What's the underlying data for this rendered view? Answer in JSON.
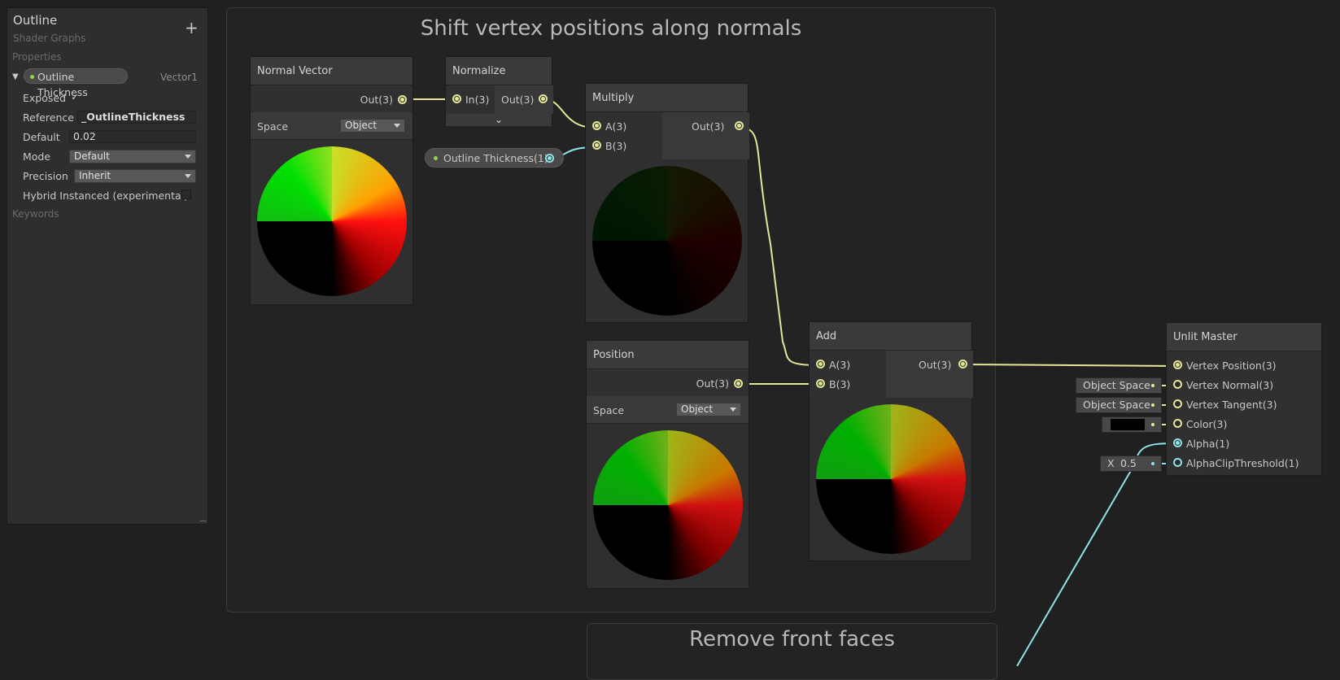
{
  "blackboard": {
    "title": "Outline",
    "subtitle": "Shader Graphs",
    "add_label": "+",
    "properties_label": "Properties",
    "property": {
      "name": "Outline Thickness",
      "type": "Vector1",
      "exposed_label": "Exposed",
      "exposed_check": "✓",
      "reference_label": "Reference",
      "reference_value": "_OutlineThickness",
      "default_label": "Default",
      "default_value": "0.02",
      "mode_label": "Mode",
      "mode_value": "Default",
      "precision_label": "Precision",
      "precision_value": "Inherit",
      "hybrid_label": "Hybrid Instanced (experimental)"
    },
    "keywords_label": "Keywords"
  },
  "groups": {
    "main_title": "Shift vertex positions along normals",
    "second_title": "Remove front faces"
  },
  "nodes": {
    "normal_vector": {
      "title": "Normal Vector",
      "out": "Out(3)",
      "space_label": "Space",
      "space_value": "Object"
    },
    "normalize": {
      "title": "Normalize",
      "in": "In(3)",
      "out": "Out(3)",
      "expand": "⌄"
    },
    "property_node": {
      "label": "Outline Thickness(1)"
    },
    "multiply": {
      "title": "Multiply",
      "a": "A(3)",
      "b": "B(3)",
      "out": "Out(3)"
    },
    "position": {
      "title": "Position",
      "out": "Out(3)",
      "space_label": "Space",
      "space_value": "Object"
    },
    "add": {
      "title": "Add",
      "a": "A(3)",
      "b": "B(3)",
      "out": "Out(3)"
    },
    "master": {
      "title": "Unlit Master",
      "ports": [
        "Vertex Position(3)",
        "Vertex Normal(3)",
        "Vertex Tangent(3)",
        "Color(3)",
        "Alpha(1)",
        "AlphaClipThreshold(1)"
      ],
      "normal_space": "Object Space",
      "tangent_space": "Object Space",
      "color_value": "#000000",
      "clip_axis": "X",
      "clip_value": "0.5"
    }
  },
  "colors": {
    "wire_vec3": "#e6e69a",
    "wire_float": "#8fe3e8",
    "accent_green": "#9ad24e"
  }
}
